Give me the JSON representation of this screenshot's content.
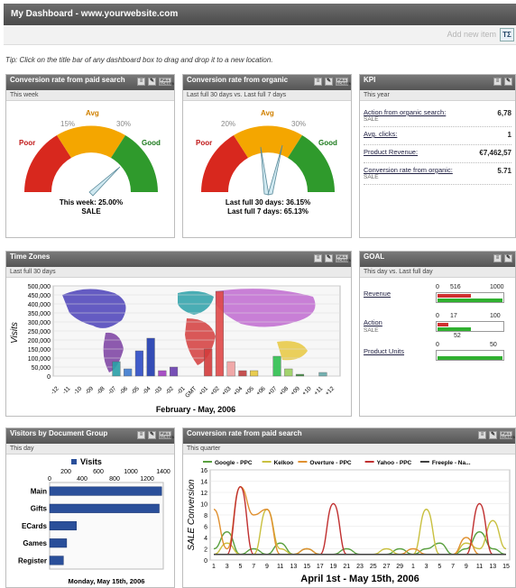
{
  "header": {
    "title": "My Dashboard - www.yourwebsite.com"
  },
  "toolbar": {
    "add_row_label": "Add new item",
    "add_button_label": "TΣ"
  },
  "tip": "Tip: Click on the title bar of any dashboard box to drag and drop it to a new location.",
  "panels": {
    "paid_search": {
      "title": "Conversion rate from paid search",
      "subtitle": "This week"
    },
    "organic": {
      "title": "Conversion rate from organic",
      "subtitle": "Last full 30 days vs. Last full 7 days"
    },
    "kpi": {
      "title": "KPI",
      "subtitle": "This year"
    },
    "timezones": {
      "title": "Time Zones",
      "subtitle": "Last full 30 days"
    },
    "goal": {
      "title": "GOAL",
      "subtitle": "This day vs. Last full day"
    },
    "visitors": {
      "title": "Visitors by Document Group",
      "subtitle": "This day"
    },
    "paid_line": {
      "title": "Conversion rate from paid search",
      "subtitle": "This quarter"
    }
  },
  "tools": {
    "full_label": "FULL SCREEN"
  },
  "gauges": {
    "paid": {
      "labels": {
        "poor": "Poor",
        "avg": "Avg",
        "good": "Good",
        "p15": "15%",
        "p30": "30%"
      },
      "line1": "This week: 25.00%",
      "line2": "SALE",
      "value_pct": 25.0
    },
    "organic": {
      "labels": {
        "poor": "Poor",
        "avg": "Avg",
        "good": "Good",
        "p15": "20%",
        "p30": "30%"
      },
      "line1": "Last full 30 days: 36.15%",
      "line2": "Last full 7 days: 65.13%",
      "value_pct_a": 36.15,
      "value_pct_b": 65.13
    }
  },
  "kpi_rows": [
    {
      "label": "Action from organic search:",
      "sub": "SALE",
      "value": "6,78"
    },
    {
      "label": "Avg. clicks:",
      "sub": "",
      "value": "1"
    },
    {
      "label": "Product Revenue:",
      "sub": "",
      "value": "€7,462,57"
    },
    {
      "label": "Conversion rate from organic:",
      "sub": "SALE",
      "value": "5.71"
    }
  ],
  "goal_rows": [
    {
      "label": "Revenue",
      "sub": "",
      "min": "0",
      "mid": "516",
      "max": "1000",
      "bar_red": 0.52,
      "bar_green": 1.0
    },
    {
      "label": "Action",
      "sub": "SALE",
      "min": "0",
      "mid": "17",
      "max": "100",
      "bar_red": 0.17,
      "bar_green": 0.52,
      "below": "52"
    },
    {
      "label": "Product Units",
      "sub": "",
      "min": "0",
      "mid": "",
      "max": "50",
      "bar_red": 0,
      "bar_green": 1.0
    }
  ],
  "chart_data": [
    {
      "type": "bar",
      "title": "",
      "xlabel": "February - May, 2006",
      "ylabel": "Visits",
      "ylim": [
        0,
        500000
      ],
      "yticks": [
        "500,000",
        "450,000",
        "400,000",
        "350,000",
        "300,000",
        "250,000",
        "200,000",
        "150,000",
        "100,000",
        "50,000",
        "0"
      ],
      "categories": [
        "-12",
        "-11",
        "-10",
        "-09",
        "-08",
        "-07",
        "-06",
        "-05",
        "-04",
        "-03",
        "-02",
        "-01",
        "GMT",
        "+01",
        "+02",
        "+03",
        "+04",
        "+05",
        "+06",
        "+07",
        "+08",
        "+09",
        "+10",
        "+11",
        "+12"
      ],
      "values": [
        0,
        0,
        0,
        0,
        0,
        80000,
        40000,
        140000,
        210000,
        30000,
        50000,
        0,
        0,
        150000,
        470000,
        80000,
        30000,
        30000,
        0,
        110000,
        40000,
        10000,
        0,
        20000,
        0
      ],
      "colors": [
        "#7a3ea1",
        "#7a3ea1",
        "#6a3fb0",
        "#4a56c8",
        "#3b6fc4",
        "#2aa0a8",
        "#3f7bd0",
        "#2d4cc6",
        "#1f3bb0",
        "#a03fc0",
        "#6a3fb0",
        "#c06ad0",
        "#e070e0",
        "#d43c3c",
        "#e04848",
        "#f0a0a0",
        "#c04040",
        "#e8c840",
        "#20a040",
        "#30c050",
        "#9bd060",
        "#3a8a3a",
        "#8ac",
        "#6aa",
        "#3a8"
      ]
    },
    {
      "type": "bar",
      "title": "",
      "legend": [
        "Visits"
      ],
      "xlim": [
        0,
        1400
      ],
      "xticks_top": [
        "200",
        "600",
        "1000",
        "1400"
      ],
      "xticks_bottom": [
        "0",
        "400",
        "800",
        "1200"
      ],
      "xlabel": "Monday, May 15th, 2006",
      "categories": [
        "Main",
        "Gifts",
        "ECards",
        "Games",
        "Register"
      ],
      "values": [
        1380,
        1350,
        330,
        210,
        170
      ]
    },
    {
      "type": "line",
      "title": "",
      "xlabel": "April 1st - May 15th, 2006",
      "ylabel": "SALE Conversion",
      "ylim": [
        0,
        16
      ],
      "yticks": [
        "0",
        "2",
        "4",
        "6",
        "8",
        "10",
        "12",
        "14",
        "16"
      ],
      "x": [
        "1",
        "3",
        "5",
        "7",
        "9",
        "11",
        "13",
        "15",
        "17",
        "19",
        "21",
        "23",
        "25",
        "27",
        "29",
        "1",
        "3",
        "5",
        "7",
        "9",
        "11",
        "13",
        "15"
      ],
      "series": [
        {
          "name": "Google - PPC",
          "color": "#5aa040",
          "values": [
            2,
            5,
            1,
            2,
            1,
            3,
            1,
            2,
            1,
            1,
            2,
            1,
            1,
            1,
            2,
            1,
            2,
            3,
            1,
            2,
            5,
            2,
            1
          ]
        },
        {
          "name": "Kelkoo",
          "color": "#c9c040",
          "values": [
            1,
            3,
            1,
            1,
            9,
            2,
            1,
            1,
            1,
            1,
            1,
            1,
            1,
            2,
            1,
            1,
            9,
            1,
            1,
            3,
            2,
            7,
            2
          ]
        },
        {
          "name": "Overture - PPC",
          "color": "#e09030",
          "values": [
            9,
            2,
            13,
            8,
            9,
            1,
            1,
            2,
            1,
            1,
            1,
            1,
            1,
            1,
            1,
            2,
            1,
            1,
            1,
            4,
            1,
            1,
            1
          ]
        },
        {
          "name": "Yahoo - PPC",
          "color": "#c03030",
          "values": [
            1,
            1,
            13,
            1,
            1,
            1,
            1,
            1,
            1,
            10,
            1,
            1,
            1,
            1,
            1,
            1,
            1,
            1,
            1,
            1,
            10,
            1,
            1
          ]
        },
        {
          "name": "Freeple - Na...",
          "color": "#404040",
          "values": [
            1,
            1,
            1,
            1,
            1,
            1,
            1,
            1,
            1,
            1,
            1,
            1,
            1,
            1,
            1,
            1,
            1,
            1,
            1,
            1,
            1,
            1,
            1
          ]
        }
      ]
    }
  ]
}
